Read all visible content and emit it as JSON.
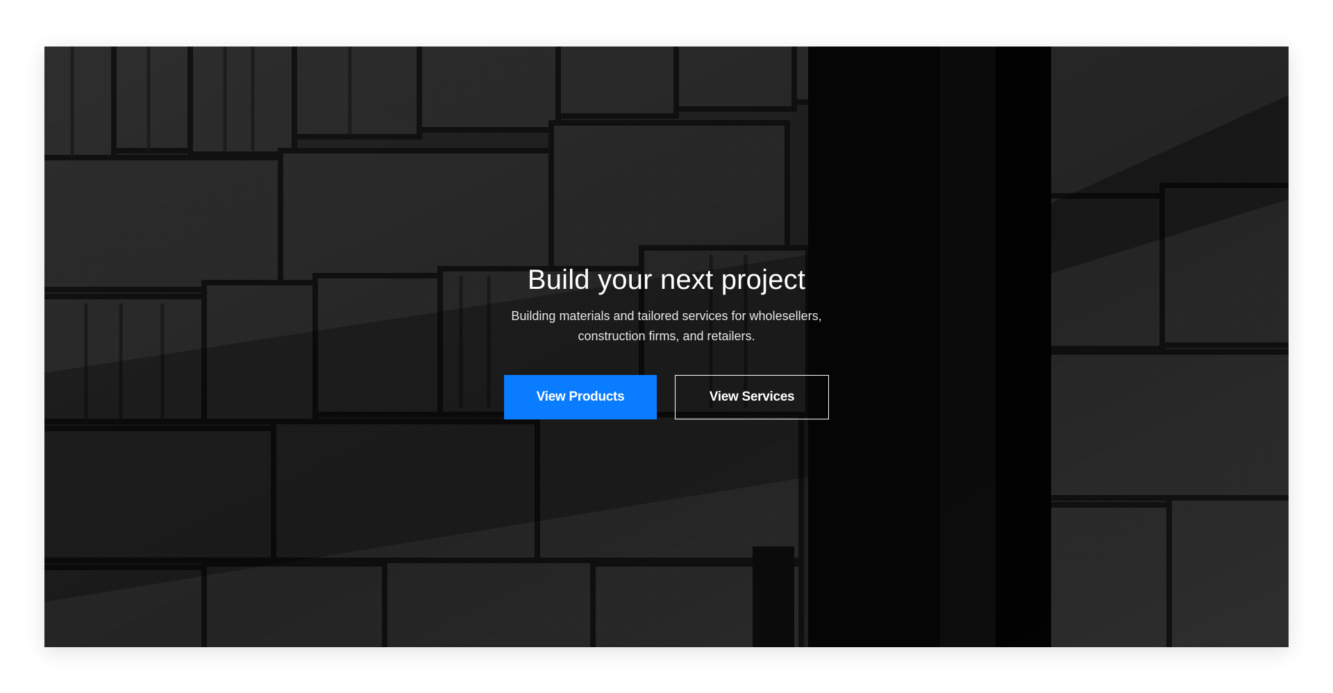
{
  "hero": {
    "title": "Build your next project",
    "subtitle": "Building materials and tailored services for wholesellers, construction firms, and retailers.",
    "primary_button": "View Products",
    "secondary_button": "View Services"
  },
  "colors": {
    "primary": "#0a7cff",
    "background": "#ffffff",
    "text": "#ffffff"
  }
}
